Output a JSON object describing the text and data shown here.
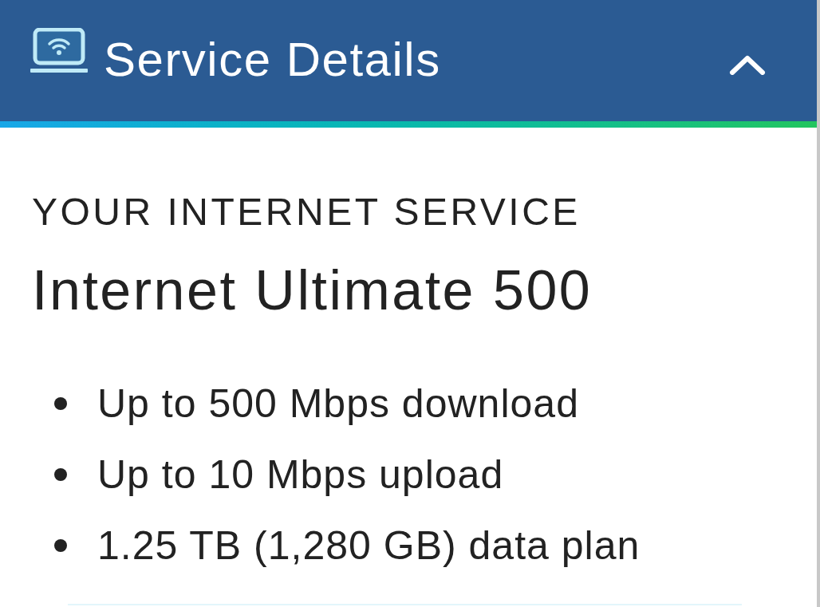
{
  "header": {
    "title": "Service Details",
    "expanded": true
  },
  "service": {
    "eyebrow": "YOUR INTERNET SERVICE",
    "plan_name": "Internet Ultimate 500",
    "features": [
      "Up to 500 Mbps download",
      "Up to 10 Mbps upload",
      "1.25 TB (1,280 GB) data plan"
    ]
  }
}
